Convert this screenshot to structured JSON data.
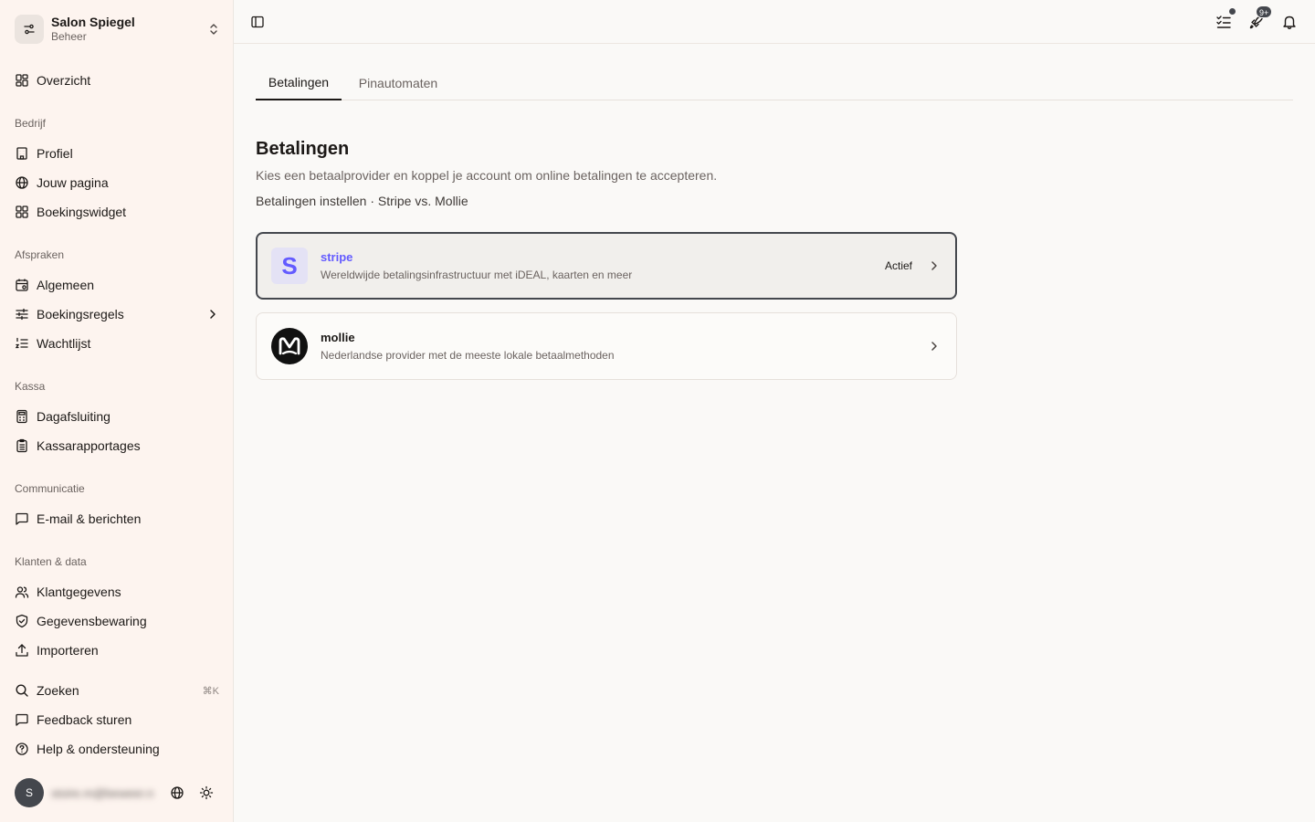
{
  "org": {
    "name": "Salon Spiegel",
    "role": "Beheer"
  },
  "nav": {
    "overview": "Overzicht",
    "groups": {
      "bedrijf": "Bedrijf",
      "afspraken": "Afspraken",
      "kassa": "Kassa",
      "communicatie": "Communicatie",
      "klanten": "Klanten & data"
    },
    "items": {
      "profiel": "Profiel",
      "jouw_pagina": "Jouw pagina",
      "boekingswidget": "Boekingswidget",
      "algemeen": "Algemeen",
      "boekingsregels": "Boekingsregels",
      "wachtlijst": "Wachtlijst",
      "dagafsluiting": "Dagafsluiting",
      "kassarapportages": "Kassarapportages",
      "email": "E-mail & berichten",
      "klantgegevens": "Klantgegevens",
      "gegevensbewaring": "Gegevensbewaring",
      "importeren": "Importeren"
    },
    "search": "Zoeken",
    "search_shortcut": "⌘K",
    "feedback": "Feedback sturen",
    "help": "Help & ondersteuning"
  },
  "user": {
    "initial": "S",
    "email": "stoire.m@beweer.nl"
  },
  "topbar": {
    "whats_new_badge": "9+"
  },
  "tabs": [
    "Betalingen",
    "Pinautomaten"
  ],
  "page": {
    "title": "Betalingen",
    "description": "Kies een betaalprovider en koppel je account om online betalingen te accepteren.",
    "link1": "Betalingen instellen",
    "separator": "·",
    "link2": "Stripe vs. Mollie"
  },
  "providers": [
    {
      "name": "stripe",
      "description": "Wereldwijde betalingsinfrastructuur met iDEAL, kaarten en meer",
      "status": "Actief",
      "brand_color": "#635bff"
    },
    {
      "name": "mollie",
      "description": "Nederlandse provider met de meeste lokale betaalmethoden",
      "status": "",
      "brand_color": "#111111"
    }
  ],
  "colors": {
    "sidebar_bg": "#fdf4ef",
    "page_bg": "#faf9f7",
    "accent": "#44474d"
  }
}
